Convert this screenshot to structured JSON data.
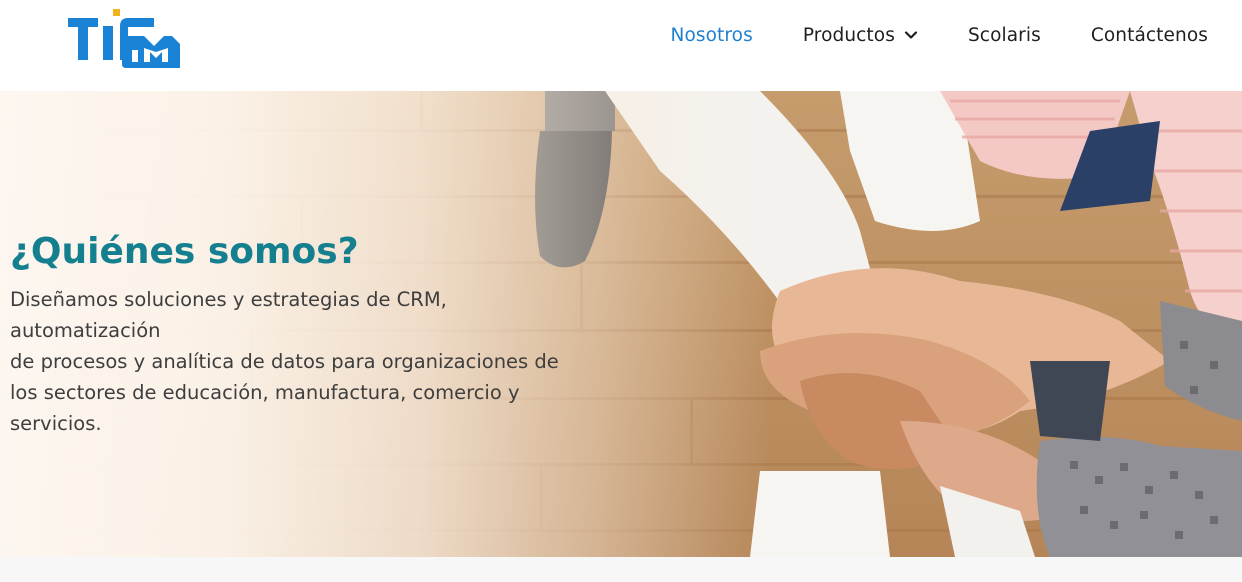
{
  "brand": {
    "logo_text": "TIM",
    "colors": {
      "logo_blue": "#1a83d6",
      "logo_accent": "#f2b21b",
      "nav_active": "#1f7fcf",
      "title_teal": "#147f8e"
    }
  },
  "nav": {
    "items": [
      {
        "label": "Nosotros",
        "active": true
      },
      {
        "label": "Productos",
        "has_dropdown": true,
        "icon": "chevron-down-icon"
      },
      {
        "label": "Scolaris"
      },
      {
        "label": "Contáctenos"
      }
    ]
  },
  "hero": {
    "title": "¿Quiénes somos?",
    "description_lines": [
      "Diseñamos soluciones y estrategias de CRM,",
      "automatización",
      "de procesos y analítica de datos para organizaciones de",
      "los sectores de educación, manufactura, comercio y",
      "servicios."
    ],
    "image": "team-hands-stacked-photo"
  }
}
